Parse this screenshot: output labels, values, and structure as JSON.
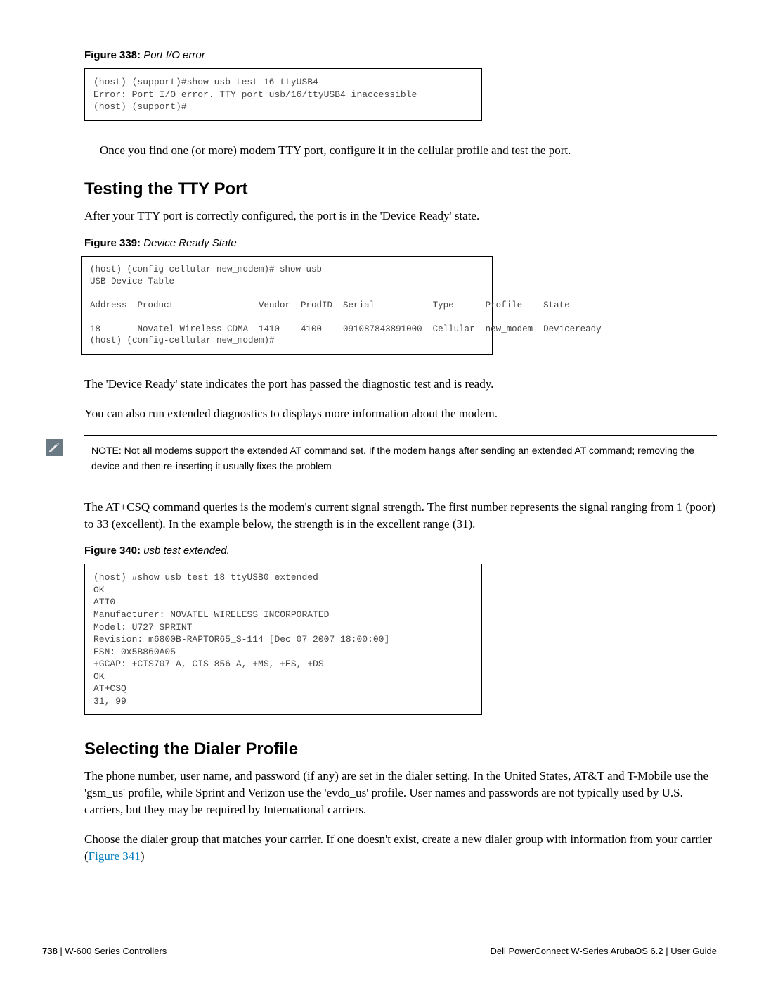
{
  "figures": {
    "f338": {
      "label": "Figure 338:",
      "title": "Port I/O error"
    },
    "f339": {
      "label": "Figure 339:",
      "title": "Device Ready State"
    },
    "f340": {
      "label": "Figure 340:",
      "title": "usb test extended."
    }
  },
  "code": {
    "f338": "(host) (support)#show usb test 16 ttyUSB4\nError: Port I/O error. TTY port usb/16/ttyUSB4 inaccessible\n(host) (support)#",
    "f339": "(host) (config-cellular new_modem)# show usb\nUSB Device Table\n----------------\nAddress  Product                Vendor  ProdID  Serial           Type      Profile    State\n-------  -------                ------  ------  ------           ----      -------    -----\n18       Novatel Wireless CDMA  1410    4100    091087843891000  Cellular  new_modem  Deviceready\n(host) (config-cellular new_modem)#",
    "f340": "(host) #show usb test 18 ttyUSB0 extended\nOK\nATI0\nManufacturer: NOVATEL WIRELESS INCORPORATED\nModel: U727 SPRINT\nRevision: m6800B-RAPTOR65_S-114 [Dec 07 2007 18:00:00]\nESN: 0x5B860A05\n+GCAP: +CIS707-A, CIS-856-A, +MS, +ES, +DS\nOK\nAT+CSQ\n31, 99"
  },
  "paragraphs": {
    "after338": "Once you find one (or more) modem TTY port, configure it in the cellular profile and test the port.",
    "tty_intro": "After your TTY port is correctly configured, the port is in the 'Device Ready' state.",
    "after339a": "The 'Device Ready' state indicates the port has passed the diagnostic test and is ready.",
    "after339b": "You can also run extended diagnostics to displays more information about the modem.",
    "note": "NOTE: Not all modems support the extended AT command set. If the modem hangs after sending an extended AT command; removing the device and then re-inserting it usually fixes the problem",
    "atcsq": "The AT+CSQ command queries is the modem's current signal strength. The first number represents the signal ranging from 1 (poor) to 33 (excellent). In the example below, the strength is in the excellent range (31).",
    "dialer1": "The phone number, user name, and password (if any) are set in the dialer setting. In the United States, AT&T and T-Mobile use the 'gsm_us' profile, while Sprint and Verizon use the 'evdo_us' profile. User names and passwords are not typically used by U.S. carriers, but they may be required by International carriers.",
    "dialer2_pre": "Choose the dialer group that matches your carrier. If one doesn't exist, create a new dialer group with information from your carrier (",
    "dialer2_link": "Figure 341",
    "dialer2_post": ")"
  },
  "headings": {
    "tty": "Testing the TTY Port",
    "dialer": "Selecting the Dialer Profile"
  },
  "footer": {
    "page": "738",
    "sep": " | ",
    "section": "W-600 Series Controllers",
    "right_product": "Dell PowerConnect W-Series ArubaOS 6.2",
    "right_doc": "User Guide"
  }
}
